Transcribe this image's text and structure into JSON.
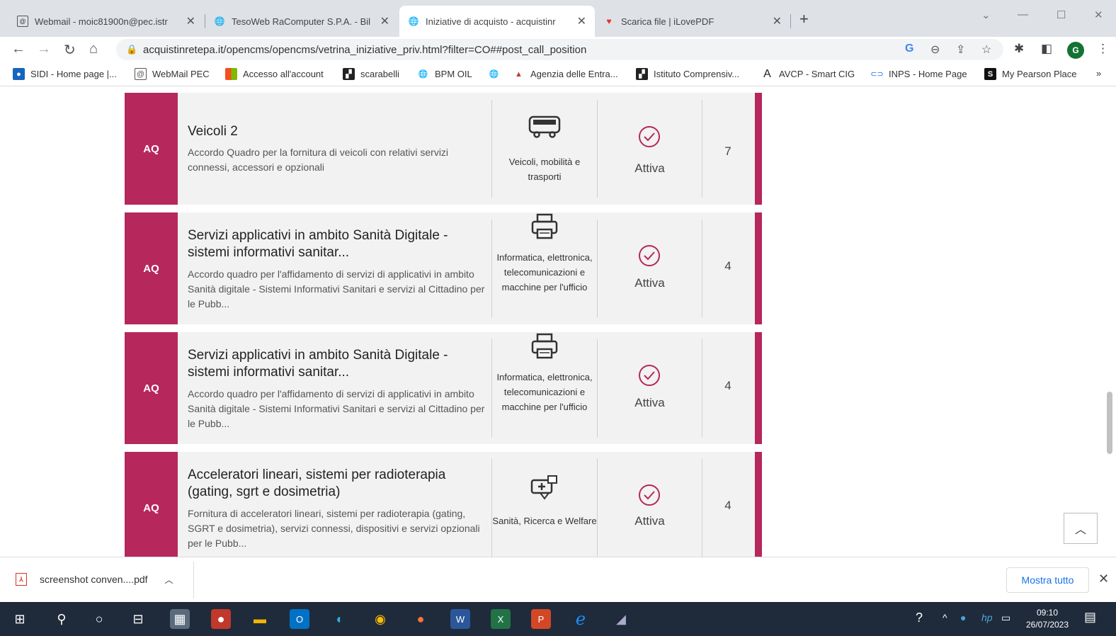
{
  "browser": {
    "tabs": [
      {
        "title": "Webmail - moic81900n@pec.istr",
        "icon": "mail-icon",
        "active": false
      },
      {
        "title": "TesoWeb RaComputer S.P.A. - Bil",
        "icon": "globe-icon",
        "active": false
      },
      {
        "title": "Iniziative di acquisto - acquistinr",
        "icon": "globe-icon",
        "active": true
      },
      {
        "title": "Scarica file | iLovePDF",
        "icon": "heart-icon",
        "active": false
      }
    ],
    "address_url": "acquistinretepa.it/opencms/opencms/vetrina_iniziative_priv.html?filter=CO##post_call_position",
    "profile_initial": "G",
    "bookmarks": [
      {
        "label": "SIDI - Home page |...",
        "icon": "sidi-icon",
        "color": "#1565c0"
      },
      {
        "label": "WebMail PEC",
        "icon": "mail-icon",
        "color": "#5f6368"
      },
      {
        "label": "Accesso all'account",
        "icon": "microsoft-icon",
        "color": "#f25022"
      },
      {
        "label": "scarabelli",
        "icon": "building-icon",
        "color": "#222222"
      },
      {
        "label": "BPM OIL",
        "icon": "globe-icon",
        "color": "#5f6368"
      },
      {
        "label": "",
        "icon": "globe-icon",
        "color": "#5f6368"
      },
      {
        "label": "Agenzia delle Entra...",
        "icon": "agency-icon",
        "color": "#c0392b"
      },
      {
        "label": "Istituto Comprensiv...",
        "icon": "building-icon",
        "color": "#222222"
      },
      {
        "label": "AVCP - Smart CIG",
        "icon": "avcp-icon",
        "color": "#222222"
      },
      {
        "label": "INPS - Home Page",
        "icon": "inps-icon",
        "color": "#1a73e8"
      },
      {
        "label": "My Pearson Place",
        "icon": "pearson-icon",
        "color": "#111111"
      }
    ]
  },
  "cards": [
    {
      "badge": "AQ",
      "title": "Veicoli 2",
      "description": "Accordo Quadro per la fornitura di veicoli con relativi servizi connessi, accessori e opzionali",
      "category": "Veicoli, mobilità e trasporti",
      "category_icon": "bus-icon",
      "status": "Attiva",
      "count": "7"
    },
    {
      "badge": "AQ",
      "title": "Servizi applicativi in ambito Sanità Digitale - sistemi informativi sanitar...",
      "description": "Accordo quadro per l'affidamento di servizi di applicativi in ambito Sanità digitale - Sistemi Informativi Sanitari e servizi al Cittadino per le Pubb...",
      "category": "Informatica, elettronica, telecomunicazioni e macchine per l'ufficio",
      "category_icon": "printer-icon",
      "status": "Attiva",
      "count": "4"
    },
    {
      "badge": "AQ",
      "title": "Servizi applicativi in ambito Sanità Digitale - sistemi informativi sanitar...",
      "description": "Accordo quadro per l'affidamento di servizi di applicativi in ambito Sanità digitale - Sistemi Informativi Sanitari e servizi al Cittadino per le Pubb...",
      "category": "Informatica, elettronica, telecomunicazioni e macchine per l'ufficio",
      "category_icon": "printer-icon",
      "status": "Attiva",
      "count": "4"
    },
    {
      "badge": "AQ",
      "title": "Acceleratori lineari, sistemi per radioterapia (gating, sgrt e dosimetria)",
      "description": "Fornitura di acceleratori lineari, sistemi per radioterapia (gating, SGRT e dosimetria), servizi connessi, dispositivi e servizi opzionali per le Pubb...",
      "category": "Sanità, Ricerca e Welfare",
      "category_icon": "medical-kit-icon",
      "status": "Attiva",
      "count": "4"
    }
  ],
  "downloads": {
    "file_name": "screenshot conven....pdf",
    "show_all_label": "Mostra tutto"
  },
  "taskbar": {
    "time": "09:10",
    "date": "26/07/2023"
  },
  "colors": {
    "accent": "#b6275c",
    "card_bg": "#f2f2f2",
    "taskbar_bg": "#1f2b3a"
  }
}
